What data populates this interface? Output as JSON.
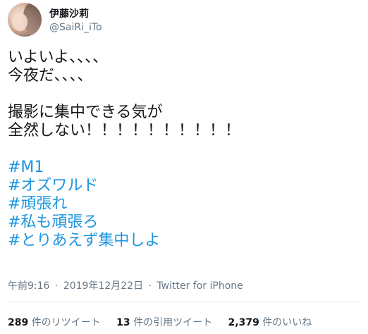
{
  "user": {
    "display_name": "伊藤沙莉",
    "screen_name": "@SaiRi_iTo"
  },
  "tweet": {
    "lines": [
      "いよいよ、、、、",
      "今夜だ、、、、",
      "",
      "撮影に集中できる気が",
      "全然しない！！！！！！！！！！"
    ],
    "hashtags": [
      "#M1",
      "#オズワルド",
      "#頑張れ",
      "#私も頑張ろ",
      "#とりあえず集中しよ"
    ],
    "time": "午前9:16",
    "date": "2019年12月22日",
    "separator": "·",
    "source": "Twitter for iPhone"
  },
  "stats": {
    "retweets_count": "289",
    "retweets_label": "件のリツイート",
    "quotes_count": "13",
    "quotes_label": "件の引用ツイート",
    "likes_count": "2,379",
    "likes_label": "件のいいね"
  },
  "colors": {
    "text": "#14171a",
    "secondary": "#657786",
    "link": "#1b95e0",
    "divider": "#e6ecf0"
  }
}
